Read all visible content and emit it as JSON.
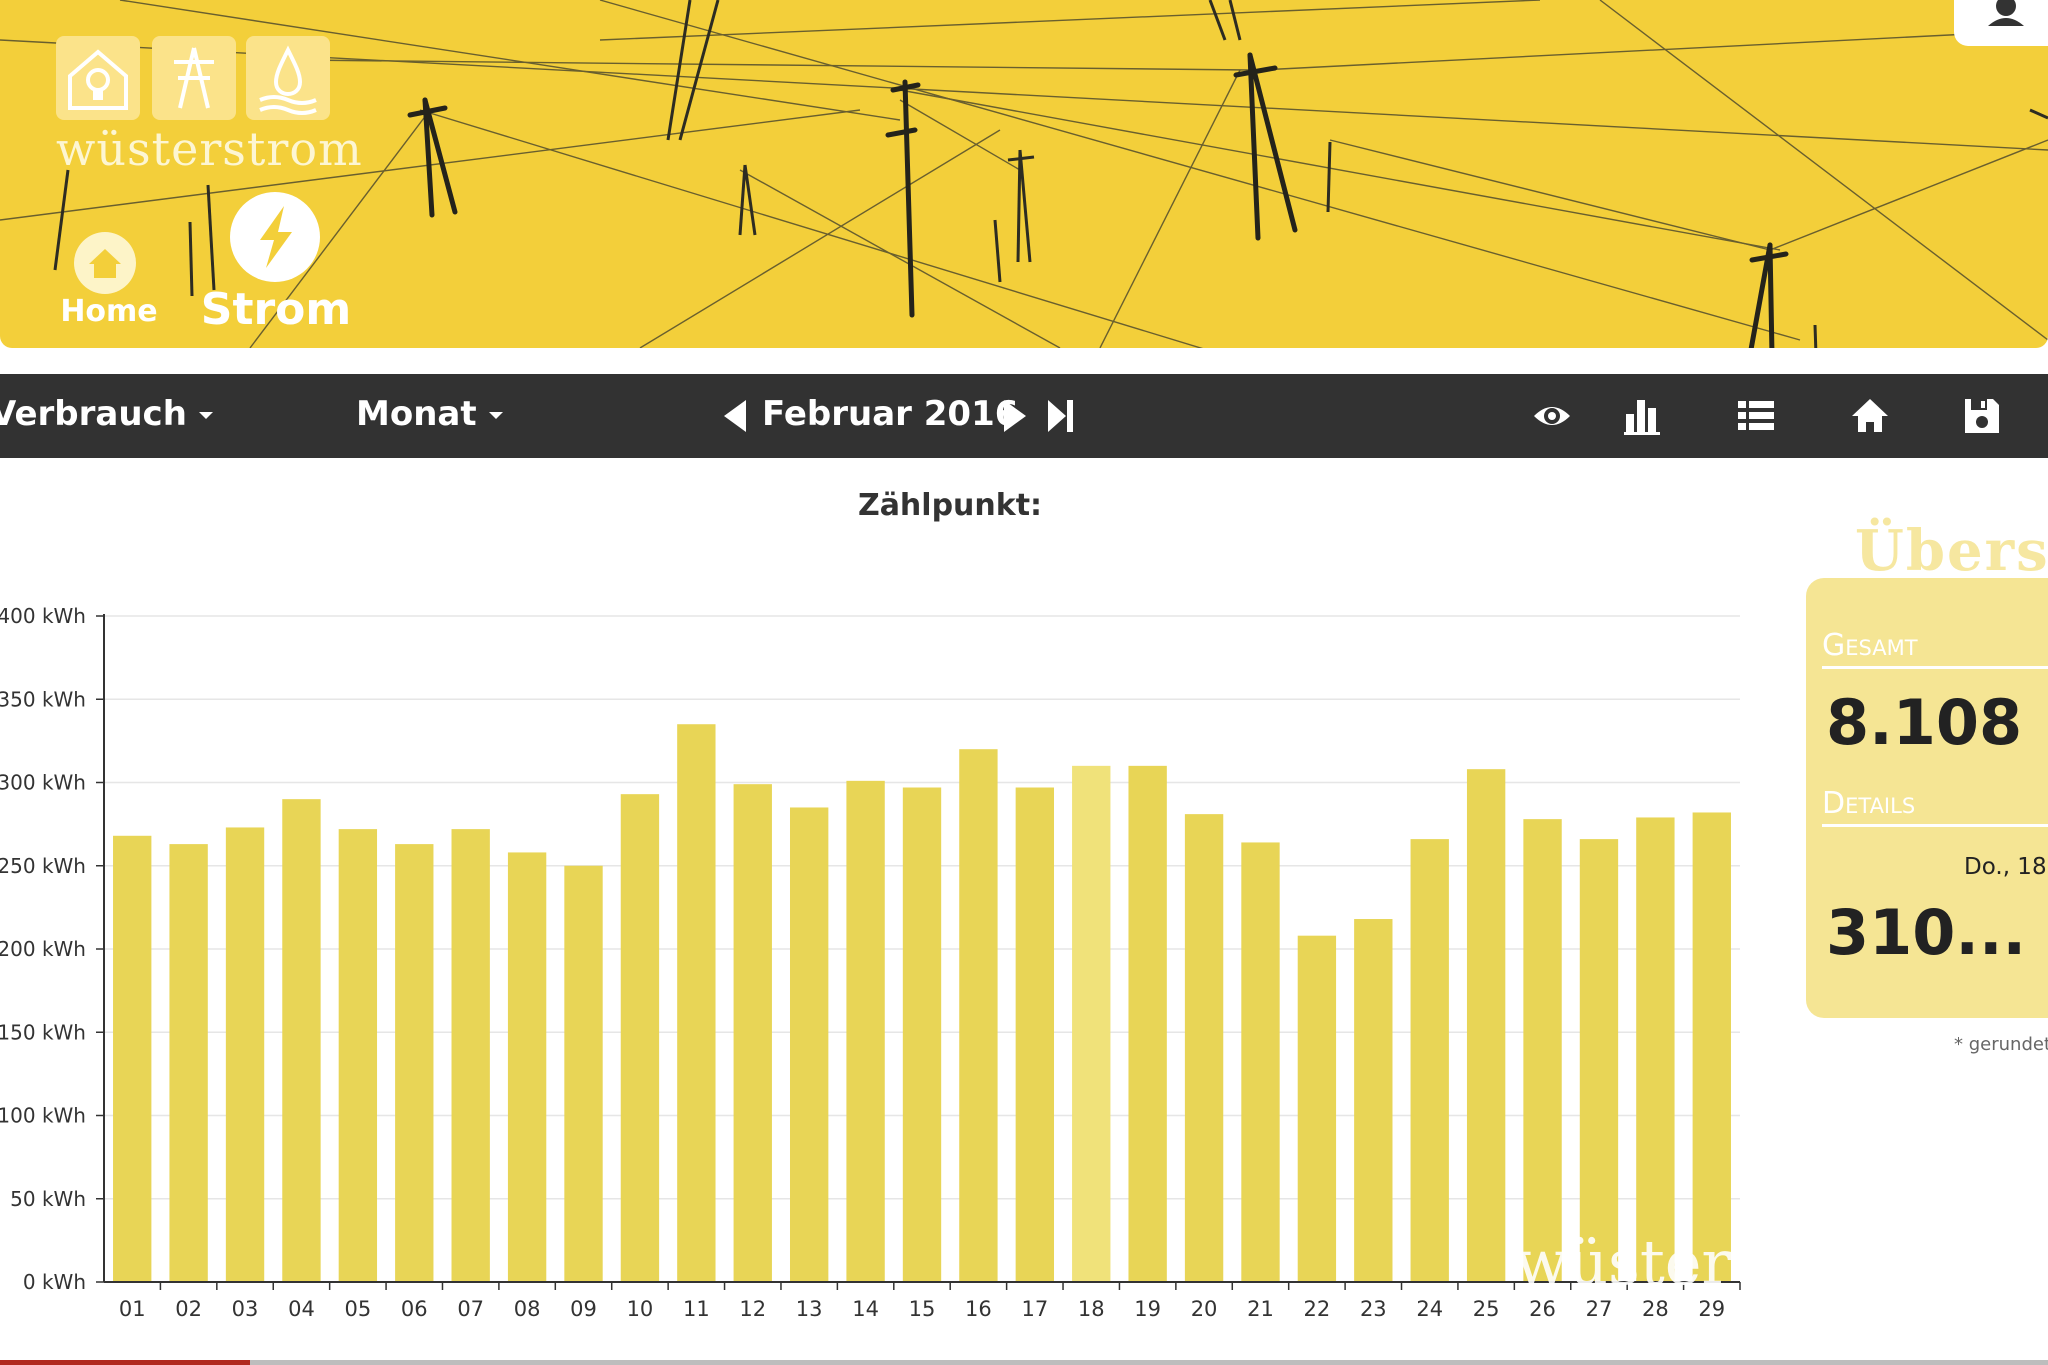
{
  "banner": {
    "brand": "wüsterstrom",
    "home_label": "Home",
    "strom_label": "Strom"
  },
  "toolbar": {
    "view_selector": "Verbrauch",
    "period_selector": "Monat",
    "period_label": "Februar 2016",
    "icons": [
      "prev-period-icon",
      "next-period-icon",
      "last-period-icon",
      "eye-icon",
      "bar-chart-icon",
      "list-icon",
      "home-icon",
      "save-icon"
    ]
  },
  "chart_title": "Zählpunkt:",
  "chart_data": {
    "type": "bar",
    "categories": [
      "01",
      "02",
      "03",
      "04",
      "05",
      "06",
      "07",
      "08",
      "09",
      "10",
      "11",
      "12",
      "13",
      "14",
      "15",
      "16",
      "17",
      "18",
      "19",
      "20",
      "21",
      "22",
      "23",
      "24",
      "25",
      "26",
      "27",
      "28",
      "29"
    ],
    "values": [
      268,
      263,
      273,
      290,
      272,
      263,
      272,
      258,
      250,
      293,
      335,
      299,
      285,
      301,
      297,
      320,
      297,
      310,
      310,
      281,
      264,
      208,
      218,
      266,
      308,
      278,
      266,
      279,
      282
    ],
    "y_ticks": [
      "0 kWh",
      "50 kWh",
      "100 kWh",
      "150 kWh",
      "200 kWh",
      "250 kWh",
      "300 kWh",
      "350 kWh",
      "400 kWh"
    ],
    "ylim": [
      0,
      400
    ],
    "grid": true,
    "highlight_index": 17,
    "bar_color": "#e8d556",
    "highlight_color": "#f0e27a",
    "watermark": "wüster"
  },
  "overview": {
    "heading": "Übersi",
    "total_label": "Gesamt",
    "total_value": "8.108",
    "details_label": "Details",
    "details_date": "Do., 18",
    "details_value": "310...",
    "note": "* gerundet"
  },
  "colors": {
    "banner": "#f3cf3a",
    "toolbar": "#323232",
    "panel": "#f5e594"
  }
}
